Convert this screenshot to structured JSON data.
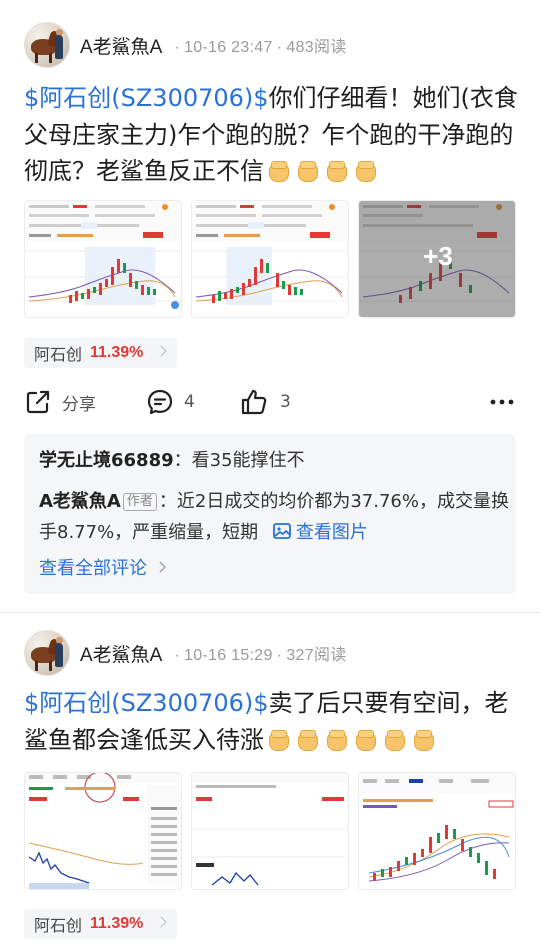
{
  "posts": [
    {
      "author": "A老鯊魚A",
      "time": "10-16 23:47",
      "reads": "483阅读",
      "stock_link": "$阿石创(SZ300706)$",
      "text": "你们仔细看！她们(衣食父母庄家主力)乍个跑的脱？乍个跑的干净跑的彻底？老鲨鱼反正不信",
      "more_images": "+3",
      "stock_tag": {
        "name": "阿石创",
        "change": "11.39%"
      },
      "actions": {
        "share": "分享",
        "comments": "4",
        "likes": "3"
      },
      "comments": [
        {
          "user": "学无止境66889",
          "sep": "：",
          "text": "看35能撑住不"
        },
        {
          "user": "A老鯊魚A",
          "badge": "作者",
          "sep": "：",
          "text": "近2日成交的均价都为37.76%，成交量换手8.77%，严重缩量，短期",
          "view_image": "查看图片"
        }
      ],
      "view_all": "查看全部评论"
    },
    {
      "author": "A老鯊魚A",
      "time": "10-16 15:29",
      "reads": "327阅读",
      "stock_link": "$阿石创(SZ300706)$",
      "text": "卖了后只要有空间，老鲨鱼都会逢低买入待涨",
      "stock_tag": {
        "name": "阿石创",
        "change": "11.39%"
      }
    }
  ],
  "colors": {
    "link": "#2a71d8",
    "up": "#e03a35",
    "down": "#1a9a4a"
  }
}
